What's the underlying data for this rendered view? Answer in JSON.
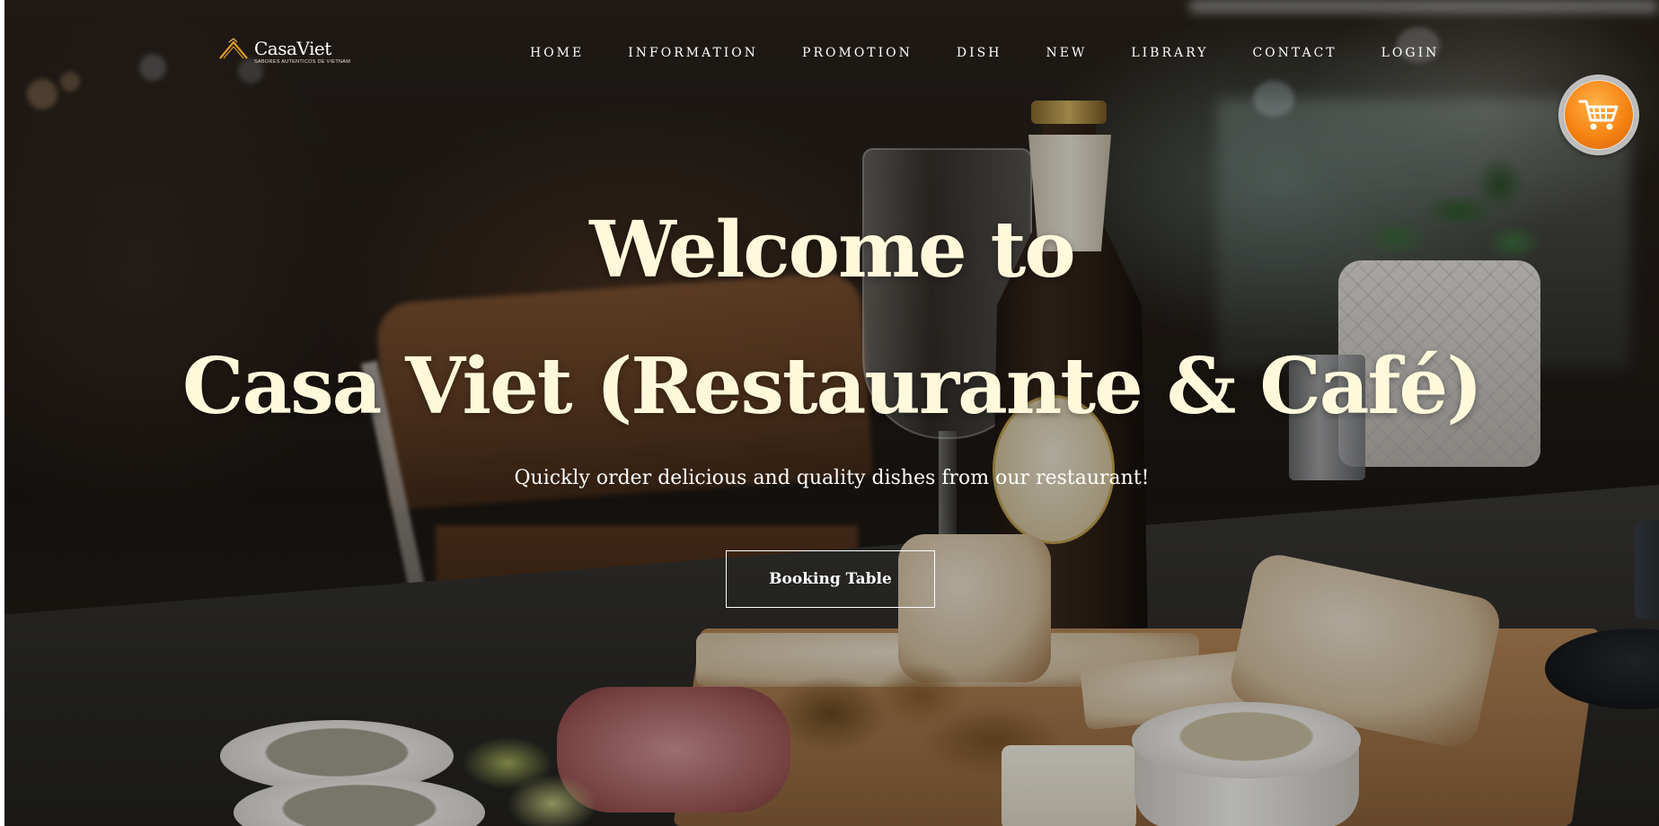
{
  "brand": {
    "name": "CasaViet",
    "tagline": "SABORES AUTENTICOS DE VIETNAM",
    "accent_color": "#d99a26"
  },
  "nav": {
    "items": [
      {
        "label": "HOME"
      },
      {
        "label": "INFORMATION"
      },
      {
        "label": "PROMOTION"
      },
      {
        "label": "DISH"
      },
      {
        "label": "NEW"
      },
      {
        "label": "LIBRARY"
      },
      {
        "label": "CONTACT"
      },
      {
        "label": "LOGIN"
      }
    ]
  },
  "cart": {
    "icon": "shopping-cart-icon",
    "color": "#f58412"
  },
  "hero": {
    "title_line1": "Welcome to",
    "title_line2": "Casa Viet (Restaurante & Café)",
    "subtitle": "Quickly order delicious and quality dishes from our restaurant!",
    "cta_label": "Booking Table",
    "title_color": "#fff9dc"
  },
  "background_image": {
    "icon": "restaurant-table-photo"
  }
}
